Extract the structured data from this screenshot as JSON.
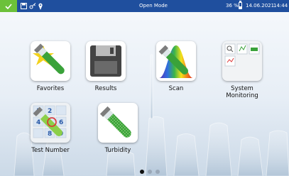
{
  "status_bar": {
    "mode": "Open Mode",
    "battery_percent": "36 %",
    "battery_level": 0.36,
    "date": "14.06.2021",
    "time": "14:44",
    "icons": [
      "check-icon",
      "save-icon",
      "key-icon",
      "location-pin-icon"
    ]
  },
  "tiles": [
    {
      "id": "favorites",
      "label": "Favorites",
      "icon": "favorites-icon"
    },
    {
      "id": "results",
      "label": "Results",
      "icon": "floppy-disk-icon"
    },
    {
      "id": "scan",
      "label": "Scan",
      "icon": "spectrum-scan-icon"
    },
    {
      "id": "system-monitoring",
      "label": "System\nMonitoring",
      "icon": "system-monitoring-icon"
    },
    {
      "id": "test-number",
      "label": "Test Number",
      "icon": "test-number-icon"
    },
    {
      "id": "turbidity",
      "label": "Turbidity",
      "icon": "turbidity-icon"
    }
  ],
  "pagination": {
    "pages": 3,
    "current": 1
  },
  "colors": {
    "status_bar": "#1f4f9e",
    "status_check": "#6cc13a",
    "tube_green": "#3aa23a",
    "star_yellow": "#f3d21b"
  }
}
